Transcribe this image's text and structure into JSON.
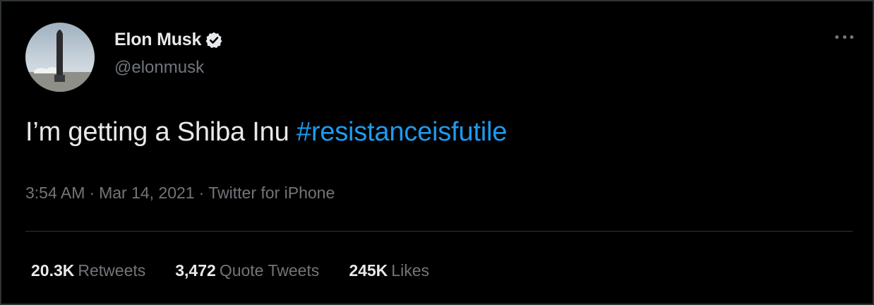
{
  "author": {
    "display_name": "Elon Musk",
    "handle": "@elonmusk",
    "verified_icon": "verified-badge-icon",
    "avatar": "starship-photo"
  },
  "tweet": {
    "text": "I’m getting a Shiba Inu ",
    "hashtag": "#resistanceisfutile",
    "time": "3:54 AM",
    "date": "Mar 14, 2021",
    "source": "Twitter for iPhone",
    "separator": "·"
  },
  "stats": {
    "retweets_count": "20.3K",
    "retweets_label": "Retweets",
    "quotes_count": "3,472",
    "quotes_label": "Quote Tweets",
    "likes_count": "245K",
    "likes_label": "Likes"
  },
  "colors": {
    "background": "#000000",
    "text": "#e7e9ea",
    "secondary": "#71767b",
    "accent": "#1d9bf0",
    "divider": "#2f3336"
  }
}
